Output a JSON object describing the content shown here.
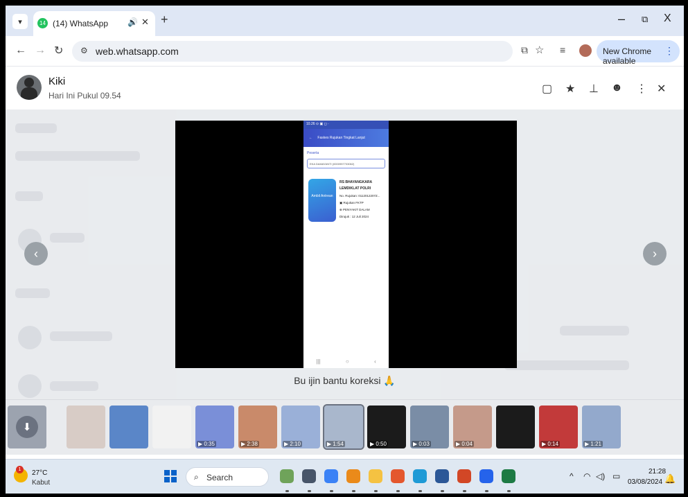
{
  "browser": {
    "tab_title": "(14) WhatsApp",
    "favicon_badge": "14",
    "tab_icons": {
      "audio": "speaker-icon",
      "close": "close-icon",
      "new_tab": "plus-icon"
    },
    "url": "web.whatsapp.com",
    "update_label": "New Chrome available",
    "window_controls": {
      "minimize": "–",
      "restore": "⧉",
      "close": "X"
    }
  },
  "viewer": {
    "sender_name": "Kiki",
    "sender_time": "Hari Ini Pukul 09.54",
    "header_icons": [
      "message-icon",
      "star-icon",
      "pin-icon",
      "emoji-icon",
      "more-icon",
      "close-icon"
    ],
    "caption": "Bu ijin bantu koreksi 🙏",
    "prev_icon": "chevron-left-icon",
    "next_icon": "chevron-right-icon"
  },
  "phone_screenshot": {
    "status": "10.26 ⊙ ▣ ◻ ·",
    "appbar_title": "Faskes Rujukan Tingkat Lanjut",
    "field_label": "Peserta",
    "input_value": "EKA DAMAYANTI (0000957703062)",
    "card_button": "Ambil Antrean",
    "lines": [
      "RS BHAYANGKARA",
      "LEMDIKLAT POLRI",
      "No. Rujukan: 0112012207Z...",
      "▣ Rujukan FKTP",
      "⊕ PENYAKIT DALAM",
      "Dirujuk : 12 Juli 2024"
    ]
  },
  "thumbnails": {
    "items": [
      {
        "color": "#d8ccc6",
        "duration": ""
      },
      {
        "color": "#5a86c8",
        "duration": ""
      },
      {
        "color": "#f2f2f2",
        "duration": ""
      },
      {
        "color": "#7a8fd8",
        "duration": "0:35"
      },
      {
        "color": "#c98a6a",
        "duration": "2:38"
      },
      {
        "color": "#9ab0d8",
        "duration": "2:10"
      },
      {
        "color": "#a9b7cc",
        "duration": "1:54"
      },
      {
        "color": "#1b1b1b",
        "duration": "0:50"
      },
      {
        "color": "#7a8da6",
        "duration": "0:03"
      },
      {
        "color": "#c59a8a",
        "duration": "0:04"
      },
      {
        "color": "#1b1b1b",
        "duration": ""
      },
      {
        "color": "#c23a3a",
        "duration": "0:14"
      },
      {
        "color": "#93a9cc",
        "duration": "1:21"
      }
    ]
  },
  "taskbar": {
    "weather_temp": "27°C",
    "weather_desc": "Kabut",
    "weather_badge": "1",
    "search_placeholder": "Search",
    "clock_time": "21:28",
    "clock_date": "03/08/2024",
    "apps": [
      {
        "name": "widgets-app-icon",
        "color": "#6fa35a"
      },
      {
        "name": "task-view-icon",
        "color": "#475569"
      },
      {
        "name": "copilot-icon",
        "color": "#3b82f6"
      },
      {
        "name": "chrome-icon",
        "color": "#ea8a1a"
      },
      {
        "name": "file-explorer-icon",
        "color": "#f5c242"
      },
      {
        "name": "store-icon",
        "color": "#e4572e"
      },
      {
        "name": "edge-icon",
        "color": "#1e9ad6"
      },
      {
        "name": "word-icon",
        "color": "#2b5797"
      },
      {
        "name": "powerpoint-icon",
        "color": "#d24726"
      },
      {
        "name": "photos-icon",
        "color": "#2563eb"
      },
      {
        "name": "excel-icon",
        "color": "#1d7a44"
      }
    ]
  }
}
